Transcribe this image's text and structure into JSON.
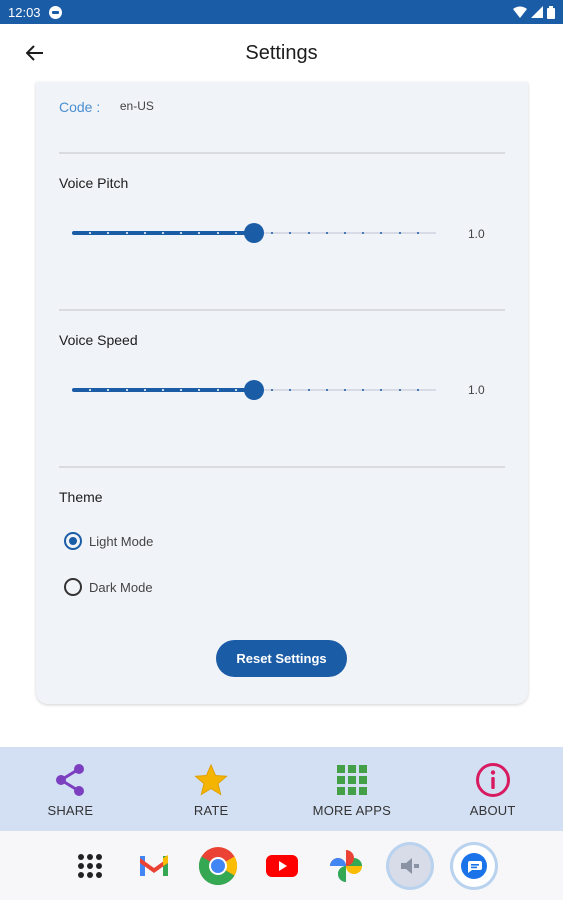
{
  "status_bar": {
    "time": "12:03"
  },
  "app_bar": {
    "title": "Settings"
  },
  "settings": {
    "code_label": "Code :",
    "code_value": "en-US",
    "pitch": {
      "title": "Voice Pitch",
      "value_text": "1.0",
      "level": 0.5
    },
    "speed": {
      "title": "Voice Speed",
      "value_text": "1.0",
      "level": 0.5
    },
    "theme": {
      "title": "Theme",
      "options": [
        {
          "label": "Light Mode",
          "selected": true
        },
        {
          "label": "Dark Mode",
          "selected": false
        }
      ]
    },
    "reset_label": "Reset Settings"
  },
  "bottom_nav": {
    "items": [
      {
        "label": "SHARE",
        "icon": "share-icon"
      },
      {
        "label": "RATE",
        "icon": "star-icon"
      },
      {
        "label": "MORE APPS",
        "icon": "grid-icon"
      },
      {
        "label": "ABOUT",
        "icon": "info-icon"
      }
    ]
  },
  "dock": {
    "apps": [
      "app-drawer-icon",
      "gmail-icon",
      "chrome-icon",
      "youtube-icon",
      "photos-icon",
      "speaker-app-icon",
      "messages-icon"
    ]
  },
  "colors": {
    "primary": "#1b5ca6",
    "nav_background": "#d3e0f4",
    "card_background": "#f0f3f8"
  }
}
